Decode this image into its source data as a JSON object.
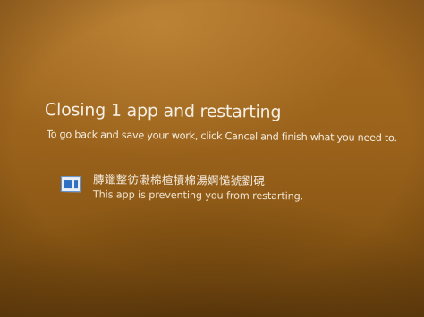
{
  "dialog": {
    "title": "Closing 1 app and restarting",
    "subtitle": "To go back and save your work, click Cancel and finish what you need to."
  },
  "blocking_apps": [
    {
      "name": "膞鑞整彷瀫棉楦犢棉湯婀慥猇劉硯",
      "status": "This app is preventing you from restarting.",
      "icon": "app-window-icon"
    }
  ],
  "colors": {
    "background": "#9a621b",
    "text": "#f6efe4",
    "icon_accent": "#2f6fc4"
  }
}
